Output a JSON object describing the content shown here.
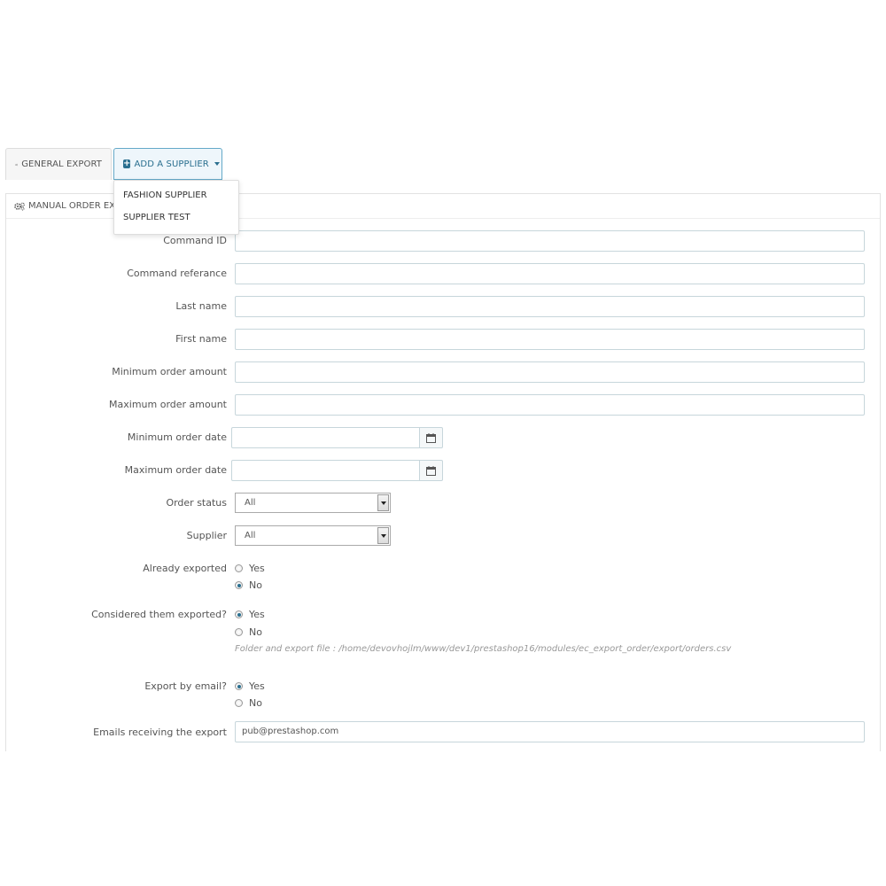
{
  "tabs": {
    "general_export": "GENERAL EXPORT",
    "add_supplier": "ADD A SUPPLIER"
  },
  "dropdown": {
    "items": [
      "FASHION SUPPLIER",
      "SUPPLIER TEST"
    ]
  },
  "panel": {
    "heading": "MANUAL ORDER EXPO"
  },
  "form": {
    "command_id": {
      "label": "Command ID",
      "value": ""
    },
    "command_reference": {
      "label": "Command referance",
      "value": ""
    },
    "last_name": {
      "label": "Last name",
      "value": ""
    },
    "first_name": {
      "label": "First name",
      "value": ""
    },
    "min_amount": {
      "label": "Minimum order amount",
      "value": ""
    },
    "max_amount": {
      "label": "Maximum order amount",
      "value": ""
    },
    "min_date": {
      "label": "Minimum order date"
    },
    "max_date": {
      "label": "Maximum order date"
    },
    "order_status": {
      "label": "Order status",
      "selected": "All"
    },
    "supplier": {
      "label": "Supplier",
      "selected": "All"
    },
    "already_exported": {
      "label": "Already exported",
      "yes": "Yes",
      "no": "No",
      "checked": "no"
    },
    "considered_exported": {
      "label": "Considered them exported?",
      "yes": "Yes",
      "no": "No",
      "checked": "yes",
      "help": "Folder and export file : /home/devovhojlm/www/dev1/prestashop16/modules/ec_export_order/export/orders.csv"
    },
    "export_email": {
      "label": "Export by email?",
      "yes": "Yes",
      "no": "No",
      "checked": "yes"
    },
    "emails": {
      "label": "Emails receiving the export",
      "value": "pub@prestashop.com"
    }
  },
  "colors": {
    "accent": "#2a6f8f",
    "border": "#c7d6db"
  }
}
